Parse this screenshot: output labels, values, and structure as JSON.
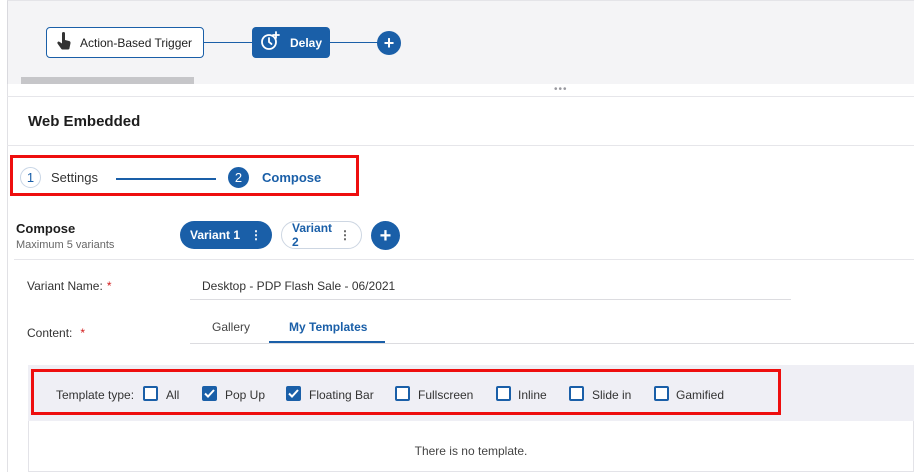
{
  "flow": {
    "trigger_label": "Action-Based Trigger",
    "delay_label": "Delay",
    "trigger_icon": "hand-pointer-icon",
    "delay_icon": "clock-plus-icon",
    "add_node_label": "+"
  },
  "section": {
    "title": "Web Embedded"
  },
  "stepper": {
    "steps": [
      {
        "number": "1",
        "label": "Settings",
        "active": false
      },
      {
        "number": "2",
        "label": "Compose",
        "active": true
      }
    ]
  },
  "compose": {
    "title": "Compose",
    "subtitle": "Maximum 5 variants",
    "variants": [
      {
        "label": "Variant 1",
        "active": true
      },
      {
        "label": "Variant 2",
        "active": false
      }
    ],
    "add_variant_label": "+",
    "variant_name_label": "Variant Name:",
    "variant_name_value": "Desktop -  PDP Flash Sale - 06/2021",
    "content_label": "Content:",
    "required_marker": "*",
    "tabs": [
      {
        "label": "Gallery",
        "active": false
      },
      {
        "label": "My Templates",
        "active": true
      }
    ]
  },
  "template_filter": {
    "label": "Template type:",
    "options": [
      {
        "label": "All",
        "checked": false
      },
      {
        "label": "Pop Up",
        "checked": true
      },
      {
        "label": "Floating Bar",
        "checked": true
      },
      {
        "label": "Fullscreen",
        "checked": false
      },
      {
        "label": "Inline",
        "checked": false
      },
      {
        "label": "Slide in",
        "checked": false
      },
      {
        "label": "Gamified",
        "checked": false
      }
    ]
  },
  "empty_message": "There is no template.",
  "colors": {
    "accent": "#1a5fa8",
    "highlight": "#ee0e0e"
  }
}
